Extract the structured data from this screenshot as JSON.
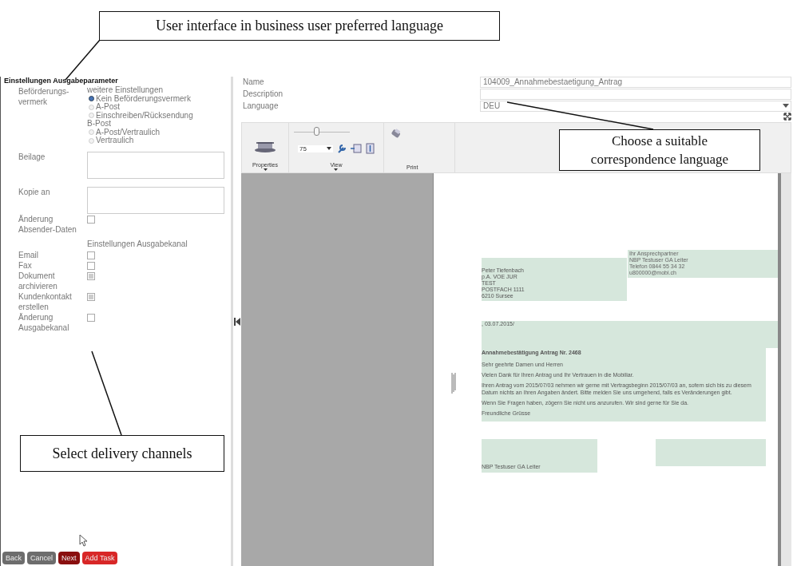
{
  "title": "Einstellungen Ausgabeparameter",
  "delivery": {
    "label": "Beförderungs-vermerk",
    "options": [
      {
        "kind": "heading",
        "label": "weitere Einstellungen"
      },
      {
        "kind": "radio",
        "label": "Kein Beförderungsvermerk",
        "selected": true
      },
      {
        "kind": "radio",
        "label": "A-Post",
        "selected": false
      },
      {
        "kind": "radio",
        "label": "Einschreiben/Rücksendung",
        "selected": false
      },
      {
        "kind": "heading",
        "label": "B-Post"
      },
      {
        "kind": "radio",
        "label": "A-Post/Vertraulich",
        "selected": false
      },
      {
        "kind": "radio",
        "label": "Vertraulich",
        "selected": false
      }
    ]
  },
  "textareas": [
    {
      "label": "Beilage"
    },
    {
      "label": "Kopie an"
    }
  ],
  "sender_change": {
    "label": "Änderung Absender-Daten",
    "checked": false
  },
  "channels": {
    "heading": "Einstellungen Ausgabekanal",
    "items": [
      {
        "label": "Email",
        "checked": false
      },
      {
        "label": "Fax",
        "checked": false
      },
      {
        "label": "Dokument archivieren",
        "checked": true
      },
      {
        "label": "Kundenkontakt erstellen",
        "checked": true
      },
      {
        "label": "Änderung Ausgabekanal",
        "checked": false
      }
    ]
  },
  "buttons": [
    {
      "label": "Back",
      "kind": "grey"
    },
    {
      "label": "Cancel",
      "kind": "grey"
    },
    {
      "label": "Next",
      "kind": "dark"
    },
    {
      "label": "Add Task",
      "kind": "red"
    }
  ],
  "fields": [
    {
      "label": "Name",
      "value": "104009_Annahmebestaetigung_Antrag",
      "kind": "text"
    },
    {
      "label": "Description",
      "kind": "text"
    },
    {
      "label": "Language",
      "value": "DEU",
      "kind": "select"
    }
  ],
  "toolbar": {
    "properties": "Properties",
    "view": "View",
    "print": "Print",
    "zoom": "75",
    "zoom_level": {
      "level": 0.4
    }
  },
  "document": {
    "recipient": [
      "Peter Tiefenbach",
      "p.A. VOE JUR",
      "TEST",
      "POSTFACH 1111",
      "6210 Sursee"
    ],
    "contact": [
      "Ihr Ansprechpartner",
      "NBP Testuser GA Leiter",
      "Telefon 0844 55 34 32",
      "u800000@mobi.ch"
    ],
    "date": ", 03.07.2015/",
    "subject": "Annahmebestätigung Antrag Nr. 2468",
    "paragraphs": [
      "Sehr geehrte Damen und Herren",
      "Vielen Dank für Ihren Antrag und Ihr Vertrauen in die Mobiliar.",
      "Ihren Antrag vom 2015/07/03 nehmen wir gerne mit Vertragsbeginn 2015/07/03 an, sofern sich bis zu diesem Datum nichts an Ihren Angaben ändert. Bitte melden Sie uns umgehend, falls es Veränderungen gibt.",
      "Wenn Sie Fragen haben, zögern Sie nicht uns anzurufen. Wir sind gerne für Sie da.",
      "Freundliche Grüsse"
    ],
    "signature": "NBP Testuser GA Leiter"
  },
  "annotations": [
    "User interface in business user preferred language",
    "Choose a suitable correspondence language",
    "Select delivery channels"
  ]
}
